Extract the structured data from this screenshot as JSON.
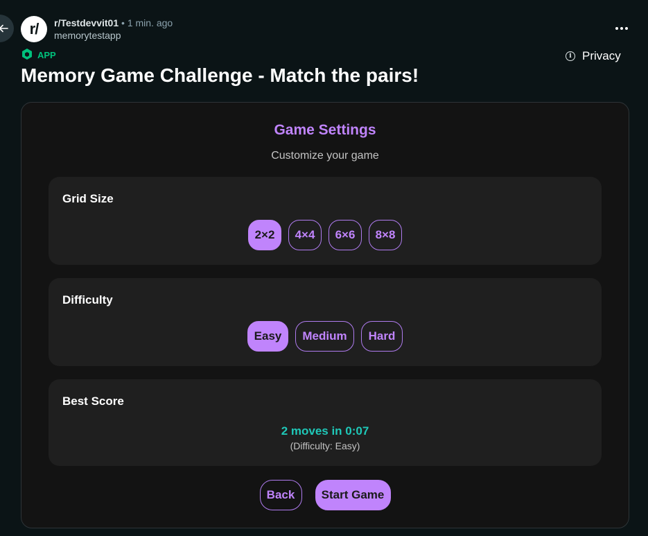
{
  "post": {
    "subreddit": "r/Testdevvit01",
    "separator": "•",
    "time": "1 min. ago",
    "author": "memorytestapp",
    "avatar_text": "r/",
    "app_badge": "APP",
    "privacy_label": "Privacy",
    "title": "Memory Game Challenge - Match the pairs!",
    "icons": {
      "back": "arrow-left-icon",
      "more": "more-options-icon",
      "app": "app-cube-icon",
      "privacy": "info-icon"
    }
  },
  "game": {
    "settings_title": "Game Settings",
    "settings_subtitle": "Customize your game",
    "grid_size": {
      "label": "Grid Size",
      "options": [
        "2×2",
        "4×4",
        "6×6",
        "8×8"
      ],
      "selected": "2×2"
    },
    "difficulty": {
      "label": "Difficulty",
      "options": [
        "Easy",
        "Medium",
        "Hard"
      ],
      "selected": "Easy"
    },
    "best_score": {
      "label": "Best Score",
      "value": "2 moves in 0:07",
      "detail": "(Difficulty: Easy)"
    },
    "buttons": {
      "back": "Back",
      "start": "Start Game"
    }
  },
  "colors": {
    "page_background": "#0b1416",
    "app_background": "#131313",
    "section_background": "#1f1f1f",
    "accent": "#c084fc",
    "score": "#1fc8b8",
    "app_badge": "#00c17c"
  }
}
